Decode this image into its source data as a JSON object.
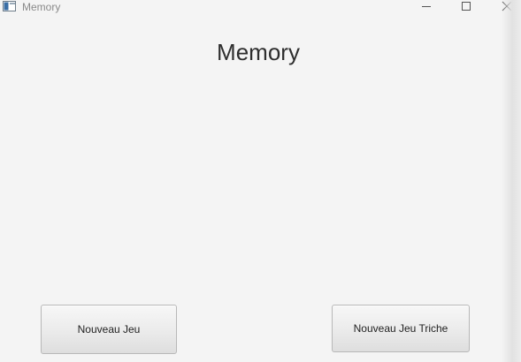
{
  "window": {
    "title": "Memory",
    "icon": "app-window-icon"
  },
  "controls": {
    "minimize_icon": "minimize-icon",
    "maximize_icon": "maximize-icon",
    "close_icon": "close-icon"
  },
  "main": {
    "heading": "Memory"
  },
  "buttons": {
    "new_game": "Nouveau Jeu",
    "new_game_cheat": "Nouveau Jeu Triche"
  },
  "colors": {
    "background": "#f4f4f4",
    "heading": "#2e2e2e",
    "title": "#8a8a8a"
  }
}
